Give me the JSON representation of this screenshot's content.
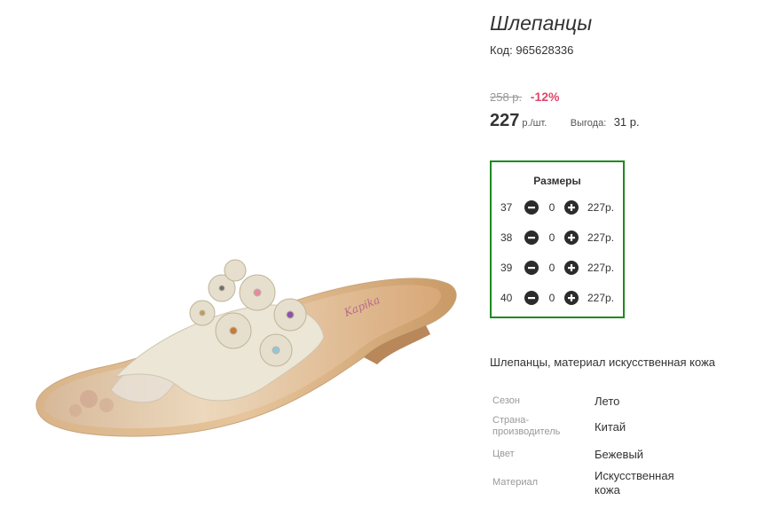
{
  "product": {
    "title": "Шлепанцы",
    "code": "Код: 965628336",
    "old_price": "258 р.",
    "discount": "-12%",
    "price": "227",
    "price_unit": "р./шт.",
    "savings_label": "Выгода:",
    "savings_value": "31 р.",
    "description": "Шлепанцы, материал искусственная кожа",
    "image_icon": "sandal-image"
  },
  "sizes": {
    "title": "Размеры",
    "rows": [
      {
        "size": "37",
        "qty": "0",
        "price": "227р."
      },
      {
        "size": "38",
        "qty": "0",
        "price": "227р."
      },
      {
        "size": "39",
        "qty": "0",
        "price": "227р."
      },
      {
        "size": "40",
        "qty": "0",
        "price": "227р."
      }
    ]
  },
  "attributes": [
    {
      "label": "Сезон",
      "value": "Лето"
    },
    {
      "label": "Страна-\nпроизводитель",
      "value": "Китай"
    },
    {
      "label": "Цвет",
      "value": "Бежевый"
    },
    {
      "label": "Материал",
      "value": "Искусственная\nкожа"
    }
  ],
  "colors": {
    "discount": "#e0466a",
    "sizes_border": "#1f8a1f",
    "button": "#2b2b2b"
  }
}
